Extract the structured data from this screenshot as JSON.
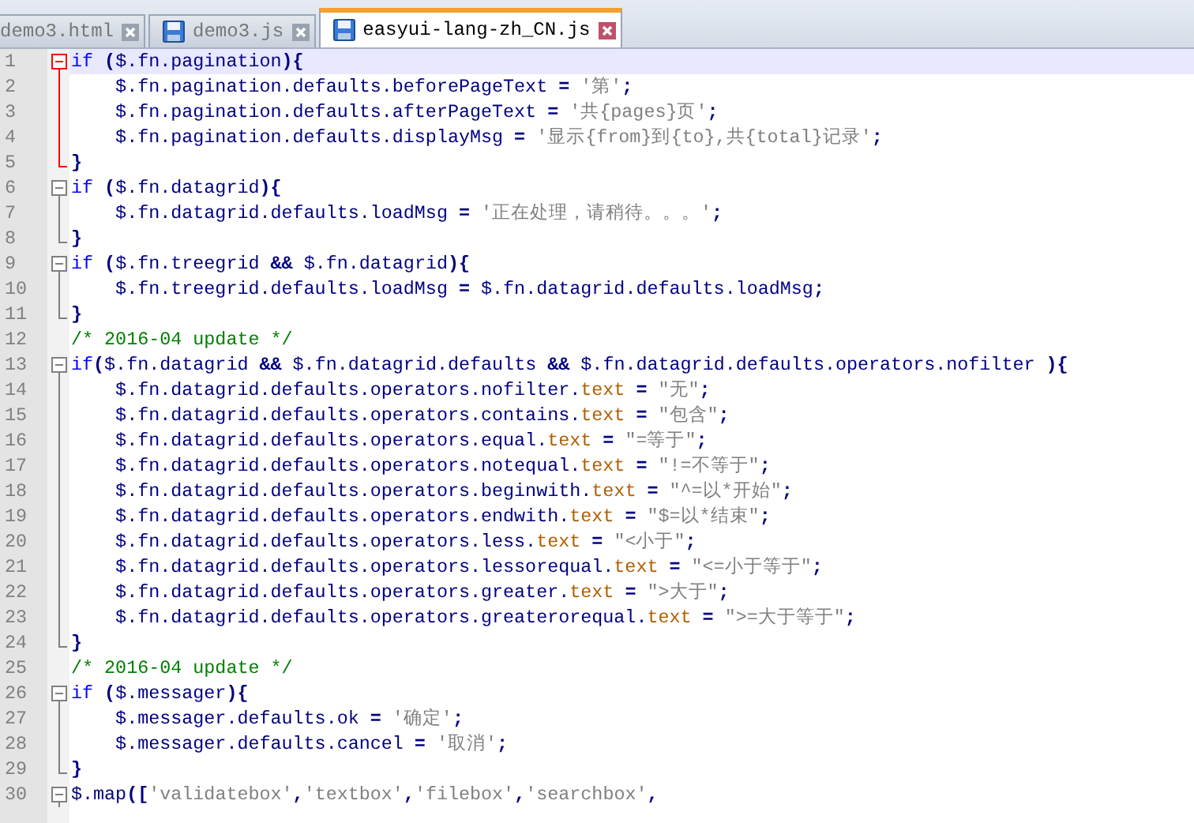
{
  "tabs": [
    {
      "label": "demo3.html",
      "selected": false
    },
    {
      "label": "demo3.js",
      "selected": false
    },
    {
      "label": "easyui-lang-zh_CN.js",
      "selected": true
    }
  ],
  "lines": [
    {
      "number": "1",
      "current": true,
      "kind": "start",
      "tokens": [
        {
          "kind": "kw",
          "text": "if"
        },
        {
          "kind": "op",
          "text": " ("
        },
        {
          "kind": "id",
          "text": "$.fn.pagination"
        },
        {
          "kind": "op",
          "text": "){"
        }
      ]
    },
    {
      "number": "2",
      "current": false,
      "kind": "body",
      "tokens": [
        {
          "kind": "id",
          "text": "    $.fn.pagination.defaults.beforePageText"
        },
        {
          "kind": "op",
          "text": " = "
        },
        {
          "kind": "str",
          "text": "'第'"
        },
        {
          "kind": "op",
          "text": ";"
        }
      ]
    },
    {
      "number": "3",
      "current": false,
      "kind": "body",
      "tokens": [
        {
          "kind": "id",
          "text": "    $.fn.pagination.defaults.afterPageText"
        },
        {
          "kind": "op",
          "text": " = "
        },
        {
          "kind": "str",
          "text": "'共{pages}页'"
        },
        {
          "kind": "op",
          "text": ";"
        }
      ]
    },
    {
      "number": "4",
      "current": false,
      "kind": "body",
      "tokens": [
        {
          "kind": "id",
          "text": "    $.fn.pagination.defaults.displayMsg"
        },
        {
          "kind": "op",
          "text": " = "
        },
        {
          "kind": "str",
          "text": "'显示{from}到{to},共{total}记录'"
        },
        {
          "kind": "op",
          "text": ";"
        }
      ]
    },
    {
      "number": "5",
      "current": false,
      "kind": "end",
      "tokens": [
        {
          "kind": "op",
          "text": "}"
        }
      ]
    },
    {
      "number": "6",
      "current": false,
      "kind": "start",
      "tokens": [
        {
          "kind": "kw",
          "text": "if"
        },
        {
          "kind": "op",
          "text": " ("
        },
        {
          "kind": "id",
          "text": "$.fn.datagrid"
        },
        {
          "kind": "op",
          "text": "){"
        }
      ]
    },
    {
      "number": "7",
      "current": false,
      "kind": "body",
      "tokens": [
        {
          "kind": "id",
          "text": "    $.fn.datagrid.defaults.loadMsg"
        },
        {
          "kind": "op",
          "text": " = "
        },
        {
          "kind": "str",
          "text": "'正在处理，请稍待。。。'"
        },
        {
          "kind": "op",
          "text": ";"
        }
      ]
    },
    {
      "number": "8",
      "current": false,
      "kind": "end",
      "tokens": [
        {
          "kind": "op",
          "text": "}"
        }
      ]
    },
    {
      "number": "9",
      "current": false,
      "kind": "start",
      "tokens": [
        {
          "kind": "kw",
          "text": "if"
        },
        {
          "kind": "op",
          "text": " ("
        },
        {
          "kind": "id",
          "text": "$.fn.treegrid"
        },
        {
          "kind": "op",
          "text": " && "
        },
        {
          "kind": "id",
          "text": "$.fn.datagrid"
        },
        {
          "kind": "op",
          "text": "){"
        }
      ]
    },
    {
      "number": "10",
      "current": false,
      "kind": "body",
      "tokens": [
        {
          "kind": "id",
          "text": "    $.fn.treegrid.defaults.loadMsg"
        },
        {
          "kind": "op",
          "text": " = "
        },
        {
          "kind": "id",
          "text": "$.fn.datagrid.defaults.loadMsg"
        },
        {
          "kind": "op",
          "text": ";"
        }
      ]
    },
    {
      "number": "11",
      "current": false,
      "kind": "end",
      "tokens": [
        {
          "kind": "op",
          "text": "}"
        }
      ]
    },
    {
      "number": "12",
      "current": false,
      "kind": "plain",
      "tokens": [
        {
          "kind": "cm",
          "text": "/* 2016-04 update */"
        }
      ]
    },
    {
      "number": "13",
      "current": false,
      "kind": "start",
      "tokens": [
        {
          "kind": "kw",
          "text": "if"
        },
        {
          "kind": "op",
          "text": "("
        },
        {
          "kind": "id",
          "text": "$.fn.datagrid"
        },
        {
          "kind": "op",
          "text": " && "
        },
        {
          "kind": "id",
          "text": "$.fn.datagrid.defaults"
        },
        {
          "kind": "op",
          "text": " && "
        },
        {
          "kind": "id",
          "text": "$.fn.datagrid.defaults.operators.nofilter"
        },
        {
          "kind": "op",
          "text": " ){"
        }
      ]
    },
    {
      "number": "14",
      "current": false,
      "kind": "body",
      "tokens": [
        {
          "kind": "id",
          "text": "    $.fn.datagrid.defaults.operators.nofilter."
        },
        {
          "kind": "pr",
          "text": "text"
        },
        {
          "kind": "op",
          "text": " = "
        },
        {
          "kind": "str",
          "text": "\"无\""
        },
        {
          "kind": "op",
          "text": ";"
        }
      ]
    },
    {
      "number": "15",
      "current": false,
      "kind": "body",
      "tokens": [
        {
          "kind": "id",
          "text": "    $.fn.datagrid.defaults.operators.contains."
        },
        {
          "kind": "pr",
          "text": "text"
        },
        {
          "kind": "op",
          "text": " = "
        },
        {
          "kind": "str",
          "text": "\"包含\""
        },
        {
          "kind": "op",
          "text": ";"
        }
      ]
    },
    {
      "number": "16",
      "current": false,
      "kind": "body",
      "tokens": [
        {
          "kind": "id",
          "text": "    $.fn.datagrid.defaults.operators.equal."
        },
        {
          "kind": "pr",
          "text": "text"
        },
        {
          "kind": "op",
          "text": " = "
        },
        {
          "kind": "str",
          "text": "\"=等于\""
        },
        {
          "kind": "op",
          "text": ";"
        }
      ]
    },
    {
      "number": "17",
      "current": false,
      "kind": "body",
      "tokens": [
        {
          "kind": "id",
          "text": "    $.fn.datagrid.defaults.operators.notequal."
        },
        {
          "kind": "pr",
          "text": "text"
        },
        {
          "kind": "op",
          "text": " = "
        },
        {
          "kind": "str",
          "text": "\"!=不等于\""
        },
        {
          "kind": "op",
          "text": ";"
        }
      ]
    },
    {
      "number": "18",
      "current": false,
      "kind": "body",
      "tokens": [
        {
          "kind": "id",
          "text": "    $.fn.datagrid.defaults.operators.beginwith."
        },
        {
          "kind": "pr",
          "text": "text"
        },
        {
          "kind": "op",
          "text": " = "
        },
        {
          "kind": "str",
          "text": "\"^=以*开始\""
        },
        {
          "kind": "op",
          "text": ";"
        }
      ]
    },
    {
      "number": "19",
      "current": false,
      "kind": "body",
      "tokens": [
        {
          "kind": "id",
          "text": "    $.fn.datagrid.defaults.operators.endwith."
        },
        {
          "kind": "pr",
          "text": "text"
        },
        {
          "kind": "op",
          "text": " = "
        },
        {
          "kind": "str",
          "text": "\"$=以*结束\""
        },
        {
          "kind": "op",
          "text": ";"
        }
      ]
    },
    {
      "number": "20",
      "current": false,
      "kind": "body",
      "tokens": [
        {
          "kind": "id",
          "text": "    $.fn.datagrid.defaults.operators.less."
        },
        {
          "kind": "pr",
          "text": "text"
        },
        {
          "kind": "op",
          "text": " = "
        },
        {
          "kind": "str",
          "text": "\"<小于\""
        },
        {
          "kind": "op",
          "text": ";"
        }
      ]
    },
    {
      "number": "21",
      "current": false,
      "kind": "body",
      "tokens": [
        {
          "kind": "id",
          "text": "    $.fn.datagrid.defaults.operators.lessorequal."
        },
        {
          "kind": "pr",
          "text": "text"
        },
        {
          "kind": "op",
          "text": " = "
        },
        {
          "kind": "str",
          "text": "\"<=小于等于\""
        },
        {
          "kind": "op",
          "text": ";"
        }
      ]
    },
    {
      "number": "22",
      "current": false,
      "kind": "body",
      "tokens": [
        {
          "kind": "id",
          "text": "    $.fn.datagrid.defaults.operators.greater."
        },
        {
          "kind": "pr",
          "text": "text"
        },
        {
          "kind": "op",
          "text": " = "
        },
        {
          "kind": "str",
          "text": "\">大于\""
        },
        {
          "kind": "op",
          "text": ";"
        }
      ]
    },
    {
      "number": "23",
      "current": false,
      "kind": "body",
      "tokens": [
        {
          "kind": "id",
          "text": "    $.fn.datagrid.defaults.operators.greaterorequal."
        },
        {
          "kind": "pr",
          "text": "text"
        },
        {
          "kind": "op",
          "text": " = "
        },
        {
          "kind": "str",
          "text": "\">=大于等于\""
        },
        {
          "kind": "op",
          "text": ";"
        }
      ]
    },
    {
      "number": "24",
      "current": false,
      "kind": "end",
      "tokens": [
        {
          "kind": "op",
          "text": "}"
        }
      ]
    },
    {
      "number": "25",
      "current": false,
      "kind": "plain",
      "tokens": [
        {
          "kind": "cm",
          "text": "/* 2016-04 update */"
        }
      ]
    },
    {
      "number": "26",
      "current": false,
      "kind": "start",
      "tokens": [
        {
          "kind": "kw",
          "text": "if"
        },
        {
          "kind": "op",
          "text": " ("
        },
        {
          "kind": "id",
          "text": "$.messager"
        },
        {
          "kind": "op",
          "text": "){"
        }
      ]
    },
    {
      "number": "27",
      "current": false,
      "kind": "body",
      "tokens": [
        {
          "kind": "id",
          "text": "    $.messager.defaults.ok"
        },
        {
          "kind": "op",
          "text": " = "
        },
        {
          "kind": "str",
          "text": "'确定'"
        },
        {
          "kind": "op",
          "text": ";"
        }
      ]
    },
    {
      "number": "28",
      "current": false,
      "kind": "body",
      "tokens": [
        {
          "kind": "id",
          "text": "    $.messager.defaults.cancel"
        },
        {
          "kind": "op",
          "text": " = "
        },
        {
          "kind": "str",
          "text": "'取消'"
        },
        {
          "kind": "op",
          "text": ";"
        }
      ]
    },
    {
      "number": "29",
      "current": false,
      "kind": "end",
      "tokens": [
        {
          "kind": "op",
          "text": "}"
        }
      ]
    },
    {
      "number": "30",
      "current": false,
      "kind": "start",
      "tokens": [
        {
          "kind": "id",
          "text": "$.map"
        },
        {
          "kind": "op",
          "text": "(["
        },
        {
          "kind": "str",
          "text": "'validatebox'"
        },
        {
          "kind": "op",
          "text": ","
        },
        {
          "kind": "str",
          "text": "'textbox'"
        },
        {
          "kind": "op",
          "text": ","
        },
        {
          "kind": "str",
          "text": "'filebox'"
        },
        {
          "kind": "op",
          "text": ","
        },
        {
          "kind": "str",
          "text": "'searchbox'"
        },
        {
          "kind": "op",
          "text": ","
        }
      ]
    }
  ]
}
